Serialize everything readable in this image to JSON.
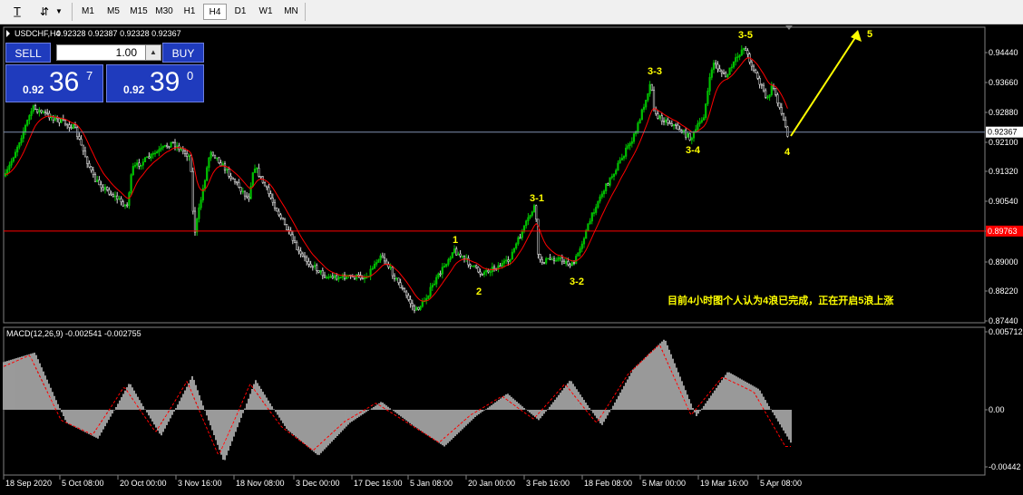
{
  "toolbar": {
    "timeframes": [
      "M1",
      "M5",
      "M15",
      "M30",
      "H1",
      "H4",
      "D1",
      "W1",
      "MN"
    ],
    "active": "H4"
  },
  "header": {
    "symbol": "USDCHF,H4",
    "ohlc": "0.92328 0.92387 0.92328 0.92367"
  },
  "trade_panel": {
    "sell_label": "SELL",
    "buy_label": "BUY",
    "lot": "1.00",
    "sell_small": "0.92",
    "sell_big": "36",
    "sell_sup": "7",
    "buy_small": "0.92",
    "buy_big": "39",
    "buy_sup": "0"
  },
  "annotation": {
    "comment": "目前4小时图个人认为4浪已完成，正在开启5浪上涨",
    "arrow_color": "#ffff00"
  },
  "current_price": "0.92367",
  "red_level": "0.89763",
  "colors": {
    "bull": "#00c000",
    "bear": "#d8d8d8",
    "ma": "#ff0000",
    "wave_label": "#ffff00",
    "hist": "#c0c0c0",
    "signal": "#ff0000"
  },
  "chart_data": [
    {
      "type": "line",
      "title": "USDCHF,H4",
      "y_ticks": [
        "0.94440",
        "0.93660",
        "0.92880",
        "0.92100",
        "0.91320",
        "0.90540",
        "0.89760",
        "0.89000",
        "0.88220",
        "0.87440"
      ],
      "x_ticks": [
        "18 Sep 2020",
        "5 Oct 08:00",
        "20 Oct 00:00",
        "3 Nov 16:00",
        "18 Nov 08:00",
        "3 Dec 00:00",
        "17 Dec 16:00",
        "5 Jan 08:00",
        "20 Jan 00:00",
        "3 Feb 16:00",
        "18 Feb 08:00",
        "5 Mar 00:00",
        "19 Mar 16:00",
        "5 Apr 08:00"
      ],
      "ylim": [
        0.8724,
        0.9495
      ],
      "series": [
        {
          "x": [
            "18 Sep 2020",
            "5 Oct 08:00",
            "20 Oct 00:00",
            "3 Nov 16:00",
            "18 Nov 08:00",
            "3 Dec 00:00",
            "17 Dec 16:00",
            "5 Jan 08:00",
            "20 Jan 00:00",
            "3 Feb 16:00",
            "18 Feb 08:00",
            "5 Mar 00:00",
            "19 Mar 16:00",
            "5 Apr 08:00"
          ],
          "y": [
            0.9108,
            0.9248,
            0.914,
            0.917,
            0.906,
            0.89,
            0.886,
            0.879,
            0.887,
            0.89,
            0.905,
            0.928,
            0.942,
            0.936
          ]
        }
      ],
      "waves": [
        {
          "label": "1",
          "x": "5 Jan 08:00",
          "y": 0.8945
        },
        {
          "label": "2",
          "x": "20 Jan 00:00",
          "y": 0.884
        },
        {
          "label": "3-1",
          "x": "3 Feb 16:00",
          "y": 0.905
        },
        {
          "label": "3-2",
          "x": "3 Feb 16:00",
          "y": 0.888
        },
        {
          "label": "3-3",
          "x": "5 Mar 00:00",
          "y": 0.937
        },
        {
          "label": "3-4",
          "x": "5 Mar 00:00",
          "y": 0.921
        },
        {
          "label": "3-5",
          "x": "19 Mar 16:00",
          "y": 0.947
        },
        {
          "label": "4",
          "x": "5 Apr 08:00",
          "y": 0.922
        },
        {
          "label": "5",
          "x": "5 Apr 08:00",
          "y": 0.947
        }
      ]
    },
    {
      "type": "bar",
      "title": "MACD(12,26,9) -0.002541 -0.002755",
      "y_ticks": [
        "0.005712",
        "0.00",
        "-0.00442"
      ],
      "ylim": [
        -0.00442,
        0.005712
      ],
      "series": [
        {
          "name": "MACD",
          "values": [
            0.0035,
            0.0042,
            -0.001,
            -0.0022,
            0.002,
            -0.002,
            0.0025,
            -0.004,
            0.0022,
            -0.0015,
            -0.0035,
            -0.001,
            0.0006,
            -0.0012,
            -0.0028,
            -0.0005,
            0.0012,
            -0.0008,
            0.0022,
            -0.0012,
            0.003,
            0.0052,
            -0.0005,
            0.0028,
            0.0015,
            -0.0025
          ]
        },
        {
          "name": "Signal",
          "values": [
            0.003,
            0.004,
            -0.0008,
            -0.0019,
            0.0017,
            -0.0017,
            0.0021,
            -0.0035,
            0.0019,
            -0.0013,
            -0.0031,
            -0.0009,
            0.0005,
            -0.001,
            -0.0025,
            -0.0004,
            0.001,
            -0.0007,
            0.0019,
            -0.001,
            0.0026,
            0.0048,
            -0.0004,
            0.0024,
            0.0013,
            -0.0028
          ]
        }
      ]
    }
  ]
}
